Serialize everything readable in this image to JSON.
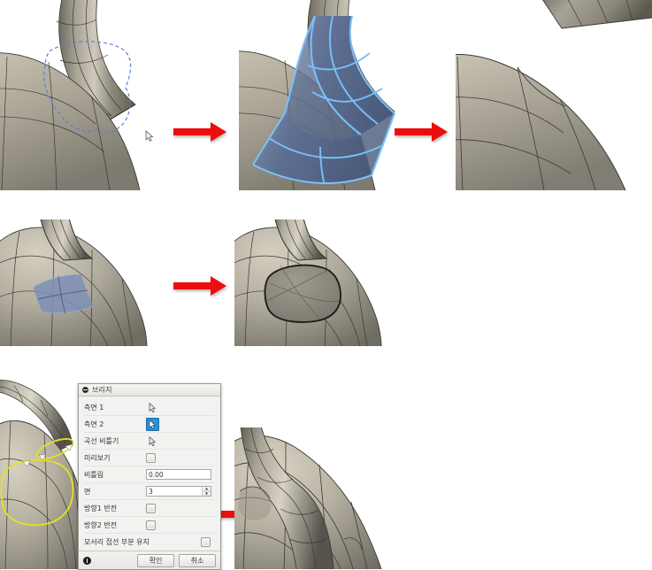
{
  "app": {
    "type": "cad-3d-modeling-tutorial",
    "description": "CAD T-Spline/Surface modeling step sequence with Bridge dialog"
  },
  "colors": {
    "arrow_red": "#ee0d0d",
    "surface_light": "#b9b3a4",
    "surface_mid": "#8e8a7e",
    "surface_dark": "#4f4d46",
    "selection_blue_fill": "#7d90b4",
    "selection_blue_edge": "#6fb6f5",
    "selection_yellow": "#e5e33a",
    "dashed_marquee": "#5a7fd4",
    "dialog_bg": "#f0f0ee",
    "dialog_accent": "#2f8fd8"
  },
  "steps": [
    {
      "id": "r1c1",
      "name": "select-loop-on-tube",
      "caption": ""
    },
    {
      "id": "r1c2",
      "name": "faces-highlighted",
      "caption": ""
    },
    {
      "id": "r1c3",
      "name": "faces-deleted-result",
      "caption": ""
    },
    {
      "id": "r2c1",
      "name": "quad-faces-selected",
      "caption": ""
    },
    {
      "id": "r2c2",
      "name": "hole-opened-result",
      "caption": ""
    },
    {
      "id": "r3c1",
      "name": "bridge-edge-loops-selected",
      "caption": ""
    },
    {
      "id": "r3c2",
      "name": "bridge-result",
      "caption": ""
    }
  ],
  "arrows": [
    {
      "name": "arrow-step1-to-step2"
    },
    {
      "name": "arrow-step2-to-step3"
    },
    {
      "name": "arrow-step4-to-step5"
    },
    {
      "name": "arrow-dialog-to-result"
    }
  ],
  "bridge_dialog": {
    "title": "브리지",
    "title_icon": "collapse-icon",
    "rows": [
      {
        "label": "측면 1",
        "control": "selection",
        "active": false,
        "icon": "cursor-arrow-icon"
      },
      {
        "label": "측면 2",
        "control": "selection",
        "active": true,
        "icon": "cursor-arrow-icon"
      },
      {
        "label": "곡선 비틀기",
        "control": "selection",
        "active": false,
        "icon": "cursor-arrow-icon"
      },
      {
        "label": "미리보기",
        "control": "checkbox",
        "checked": false
      },
      {
        "label": "비틀림",
        "control": "text",
        "value": "0.00"
      },
      {
        "label": "면",
        "control": "spinner",
        "value": "3"
      },
      {
        "label": "방향1 반전",
        "control": "checkbox",
        "checked": false
      },
      {
        "label": "방향2 반전",
        "control": "checkbox",
        "checked": false
      },
      {
        "label": "모서리 접선 부분 유지",
        "control": "checkbox",
        "checked": false
      }
    ],
    "footer": {
      "info_icon": "info-icon",
      "ok_label": "확인",
      "cancel_label": "취소"
    }
  }
}
